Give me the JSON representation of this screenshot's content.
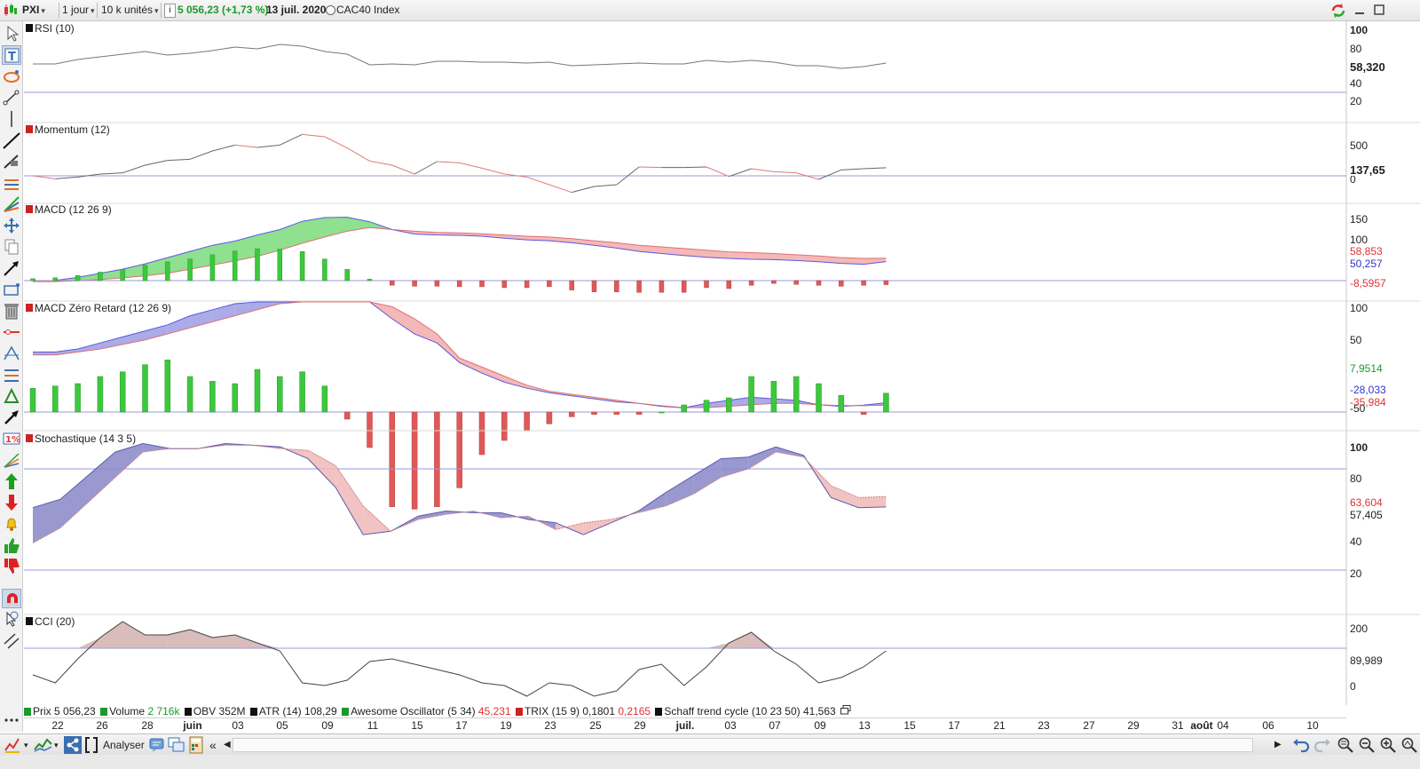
{
  "toolbar": {
    "symbol": "PXI",
    "period": "1 jour",
    "units": "10 k unités",
    "info_icon": "i",
    "price": "5 056,23 (+1,73 %)",
    "date": "13 juil. 2020",
    "index": "CAC40 Index",
    "price_color": "#1a9a2a"
  },
  "panels": {
    "rsi": {
      "label": "RSI (10)",
      "ticks": [
        "100",
        "80",
        "40",
        "20"
      ],
      "value": "58,320"
    },
    "momentum": {
      "label": "Momentum (12)",
      "ticks": [
        "500",
        "0"
      ],
      "value": "137,65"
    },
    "macd": {
      "label": "MACD (12 26 9)",
      "ticks": [
        "150",
        "100"
      ],
      "values": [
        "58,853",
        "50,257",
        "-8,5957"
      ]
    },
    "macdz": {
      "label": "MACD Zéro Retard (12 26 9)",
      "ticks": [
        "100",
        "50",
        "-50"
      ],
      "values": [
        "7,9514",
        "-28,033",
        "-35,984"
      ]
    },
    "stoch": {
      "label": "Stochastique (14 3 5)",
      "ticks": [
        "100",
        "80",
        "40",
        "20"
      ],
      "values": [
        "63,604",
        "57,405"
      ]
    },
    "cci": {
      "label": "CCI (20)",
      "ticks": [
        "200",
        "0"
      ],
      "value": "89,989"
    }
  },
  "legend": [
    {
      "name": "Prix",
      "value": "5 056,23",
      "color": "#1a9a2a"
    },
    {
      "name": "Volume",
      "value": "2 716k",
      "color": "#1a9a2a"
    },
    {
      "name": "OBV",
      "value": "352M",
      "color": "#222222"
    },
    {
      "name": "ATR (14)",
      "value": "108,29",
      "color": "#222222"
    },
    {
      "name": "Awesome Oscillator (5 34)",
      "value": "45,231",
      "color": "#d23a3a"
    },
    {
      "name": "TRIX (15 9)",
      "value": "0,1801",
      "value2": "0,2165",
      "color": "#222222",
      "color2": "#d23a3a"
    },
    {
      "name": "Schaff trend cycle (10 23 50)",
      "value": "41,563",
      "color": "#222222"
    }
  ],
  "xaxis": [
    "22",
    "26",
    "28",
    "juin",
    "03",
    "05",
    "09",
    "11",
    "15",
    "17",
    "19",
    "23",
    "25",
    "29",
    "juil.",
    "03",
    "07",
    "09",
    "13",
    "15",
    "17",
    "21",
    "23",
    "27",
    "29",
    "31",
    "août",
    "04",
    "06",
    "10"
  ],
  "bottom": {
    "analyze_label": "Analyser"
  },
  "colors": {
    "up": "#3cc83c",
    "down": "#e05858",
    "blue_fill": "#8f8fe0",
    "red_fill": "#f0a0a0",
    "green_fill": "#8fe08f",
    "ref_line": "#9a9ad8"
  },
  "chart_data": [
    {
      "type": "line",
      "title": "RSI (10)",
      "x": [
        0,
        1,
        2,
        3,
        4,
        5,
        6,
        7,
        8,
        9,
        10,
        11,
        12,
        13,
        14,
        15,
        16,
        17,
        18,
        19,
        20,
        21,
        22,
        23,
        24,
        25,
        26,
        27,
        28,
        29,
        30,
        31,
        32,
        33,
        34,
        35,
        36,
        37,
        38
      ],
      "values": [
        62,
        62,
        67,
        70,
        73,
        76,
        72,
        74,
        77,
        81,
        79,
        84,
        82,
        76,
        73,
        61,
        62,
        61,
        65,
        65,
        64,
        64,
        63,
        64,
        60,
        61,
        62,
        63,
        62,
        62,
        66,
        64,
        66,
        64,
        60,
        60,
        57,
        59,
        63
      ],
      "ylim": [
        0,
        100
      ]
    },
    {
      "type": "line",
      "title": "Momentum (12)",
      "x": [
        0,
        1,
        2,
        3,
        4,
        5,
        6,
        7,
        8,
        9,
        10,
        11,
        12,
        13,
        14,
        15,
        16,
        17,
        18,
        19,
        20,
        21,
        22,
        23,
        24,
        25,
        26,
        27,
        28,
        29,
        30,
        31,
        32,
        33,
        34,
        35,
        36,
        37,
        38
      ],
      "values": [
        0,
        -50,
        -20,
        30,
        50,
        180,
        260,
        280,
        420,
        520,
        480,
        520,
        700,
        660,
        470,
        250,
        180,
        30,
        240,
        220,
        130,
        30,
        -20,
        -150,
        -280,
        -180,
        -150,
        150,
        140,
        140,
        150,
        -10,
        120,
        70,
        50,
        -60,
        100,
        120,
        137.65
      ]
    },
    {
      "type": "bar",
      "title": "MACD (12 26 9)",
      "series": [
        {
          "name": "MACD",
          "values": [
            2,
            5,
            12,
            22,
            32,
            45,
            60,
            75,
            90,
            100,
            115,
            128,
            148,
            157,
            158,
            147,
            128,
            117,
            115,
            114,
            112,
            107,
            103,
            101,
            96,
            90,
            83,
            75,
            70,
            65,
            61,
            58,
            56,
            55,
            53,
            50,
            46,
            44,
            50.257
          ]
        },
        {
          "name": "Signal",
          "values": [
            2,
            2,
            4,
            7,
            11,
            16,
            22,
            32,
            42,
            52,
            63,
            78,
            95,
            110,
            124,
            133,
            128,
            124,
            121,
            120,
            118,
            115,
            112,
            110,
            106,
            101,
            96,
            90,
            86,
            82,
            78,
            74,
            72,
            70,
            67,
            64,
            60,
            58,
            58.853
          ]
        },
        {
          "name": "Histogramme",
          "values": [
            4,
            6,
            11,
            18,
            24,
            33,
            40,
            46,
            55,
            63,
            68,
            67,
            62,
            46,
            24,
            3,
            -10,
            -12,
            -12,
            -13,
            -13,
            -15,
            -15,
            -13,
            -20,
            -24,
            -24,
            -25,
            -25,
            -25,
            -15,
            -17,
            -10,
            -6,
            -8,
            -10,
            -12,
            -10,
            -8.5957
          ]
        }
      ]
    },
    {
      "type": "bar",
      "title": "MACD Zéro Retard (12 26 9)",
      "series": [
        {
          "name": "MACD ZR",
          "values": [
            140,
            140,
            150,
            170,
            190,
            210,
            230,
            260,
            280,
            300,
            320,
            340,
            350,
            360,
            340,
            330,
            250,
            200,
            170,
            105,
            70,
            40,
            20,
            5,
            -5,
            -15,
            -25,
            -30,
            -40,
            -45,
            -30,
            -20,
            -10,
            -15,
            -20,
            -35,
            -40,
            -36,
            -28.033
          ]
        },
        {
          "name": "Signal",
          "values": [
            130,
            130,
            140,
            150,
            165,
            180,
            200,
            220,
            240,
            260,
            280,
            300,
            320,
            340,
            345,
            335,
            290,
            250,
            200,
            120,
            90,
            60,
            30,
            10,
            0,
            -10,
            -20,
            -30,
            -38,
            -44,
            -44,
            -40,
            -35,
            -30,
            -30,
            -35,
            -37,
            -38,
            -35.984
          ]
        },
        {
          "name": "Histogramme",
          "values": [
            10,
            11,
            12,
            15,
            17,
            20,
            22,
            15,
            13,
            12,
            18,
            15,
            17,
            11,
            -3,
            -15,
            -40,
            -41,
            -40,
            -32,
            -18,
            -12,
            -8,
            -5,
            -2,
            -1,
            -1,
            -1,
            0,
            3,
            5,
            6,
            15,
            13,
            15,
            12,
            7,
            -1,
            7.9514
          ]
        }
      ]
    },
    {
      "type": "area",
      "title": "Stochastique (14 3 5)",
      "series": [
        {
          "name": "%K",
          "values": [
            57,
            62,
            76,
            90,
            95,
            92,
            92,
            95,
            94,
            93,
            86,
            69,
            41,
            43,
            52,
            55,
            54,
            54,
            50,
            48,
            41,
            48,
            55,
            66,
            76,
            86,
            87,
            93,
            88,
            63,
            57,
            57.405
          ]
        },
        {
          "name": "%D",
          "values": [
            36,
            45,
            60,
            75,
            90,
            92,
            92,
            94,
            94,
            92,
            91,
            82,
            58,
            43,
            50,
            53,
            55,
            51,
            52,
            44,
            48,
            50,
            54,
            58,
            65,
            75,
            80,
            90,
            87,
            70,
            63,
            63.604
          ]
        }
      ],
      "ylim": [
        0,
        100
      ]
    },
    {
      "type": "line",
      "title": "CCI (20)",
      "x": [
        0,
        1,
        2,
        3,
        4,
        5,
        6,
        7,
        8,
        9,
        10,
        11,
        12,
        13,
        14,
        15,
        16,
        17,
        18,
        19,
        20,
        21,
        22,
        23,
        24,
        25,
        26,
        27,
        28,
        29,
        30,
        31,
        32,
        33,
        34,
        35,
        36,
        37,
        38
      ],
      "values": [
        0,
        -30,
        60,
        140,
        200,
        150,
        150,
        170,
        140,
        150,
        120,
        90,
        -30,
        -40,
        -20,
        50,
        60,
        40,
        20,
        0,
        -30,
        -40,
        -80,
        -30,
        -40,
        -80,
        -60,
        20,
        40,
        -40,
        30,
        120,
        160,
        90,
        40,
        -30,
        -10,
        30,
        89.989
      ]
    }
  ]
}
